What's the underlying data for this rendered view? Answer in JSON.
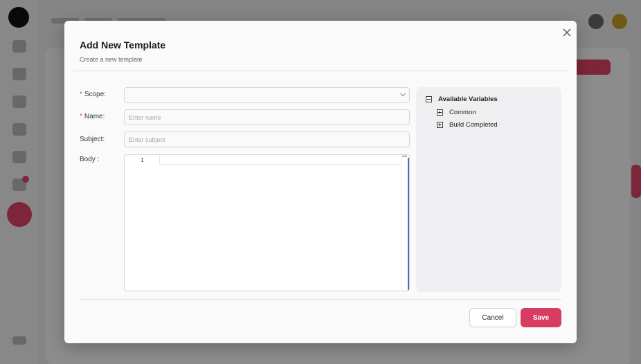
{
  "modal": {
    "title": "Add New Template",
    "subtitle": "Create a new template",
    "close_icon": "close-icon"
  },
  "form": {
    "scope": {
      "label": "Scope",
      "required": true,
      "value": ""
    },
    "name": {
      "label": "Name",
      "required": true,
      "placeholder": "Enter name",
      "value": ""
    },
    "subject": {
      "label": "Subject",
      "required": false,
      "placeholder": "Enter subject",
      "value": ""
    },
    "body": {
      "label": "Body",
      "line_numbers": [
        "1"
      ]
    },
    "label_separator": ":"
  },
  "variables": {
    "title": "Available Variables",
    "expanded": true,
    "items": [
      {
        "label": "Common",
        "expanded": false
      },
      {
        "label": "Build Completed",
        "expanded": false
      }
    ]
  },
  "actions": {
    "cancel_label": "Cancel",
    "save_label": "Save"
  },
  "colors": {
    "accent": "#d83c63",
    "required_marker": "#e3456b",
    "editor_gutter_accent": "#3b6ed6"
  }
}
